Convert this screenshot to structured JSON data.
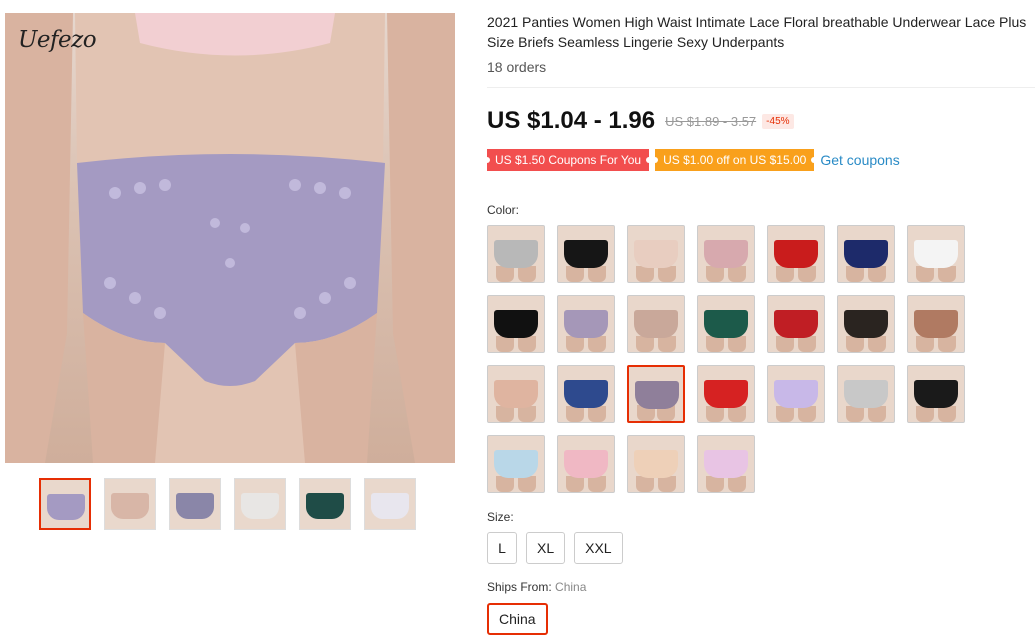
{
  "gallery": {
    "brand": "Uefezo",
    "thumbnails": [
      {
        "name": "thumb-1",
        "color": "#a49ac2",
        "active": true
      },
      {
        "name": "thumb-2",
        "color": "#d8b6a7",
        "active": false
      },
      {
        "name": "thumb-3",
        "color": "#8a86a8",
        "active": false
      },
      {
        "name": "thumb-4",
        "color": "#e8e6e4",
        "active": false
      },
      {
        "name": "thumb-5",
        "color": "#1f4c47",
        "active": false
      },
      {
        "name": "thumb-6",
        "color": "#e8e6ee",
        "active": false
      }
    ]
  },
  "product": {
    "title": "2021 Panties Women High Waist Intimate Lace Floral breathable Underwear Lace Plus Size Briefs Seamless Lingerie Sexy Underpants",
    "orders": "18 orders",
    "price": "US $1.04 - 1.96",
    "original_price": "US $1.89 - 3.57",
    "discount": "-45%",
    "coupons": {
      "coupon_1": "US $1.50 Coupons For You",
      "coupon_2": "US $1.00 off on US $15.00",
      "get_coupons": "Get coupons"
    },
    "color_label": "Color:",
    "colors": [
      {
        "color": "#b8b8b8",
        "selected": false
      },
      {
        "color": "#161616",
        "selected": false
      },
      {
        "color": "#e8cdc0",
        "selected": false
      },
      {
        "color": "#d7a9ae",
        "selected": false
      },
      {
        "color": "#c91c1c",
        "selected": false
      },
      {
        "color": "#1d2a6a",
        "selected": false
      },
      {
        "color": "#f4f4f4",
        "selected": false
      },
      {
        "color": "#111111",
        "selected": false
      },
      {
        "color": "#a597b8",
        "selected": false
      },
      {
        "color": "#c9a89a",
        "selected": false
      },
      {
        "color": "#1c5a4a",
        "selected": false
      },
      {
        "color": "#c01e24",
        "selected": false
      },
      {
        "color": "#2a2420",
        "selected": false
      },
      {
        "color": "#b07a62",
        "selected": false
      },
      {
        "color": "#dfb4a0",
        "selected": false
      },
      {
        "color": "#2e4a8e",
        "selected": false
      },
      {
        "color": "#8f7f9a",
        "selected": true
      },
      {
        "color": "#d62222",
        "selected": false
      },
      {
        "color": "#c8b8e8",
        "selected": false
      },
      {
        "color": "#c8c8c8",
        "selected": false
      },
      {
        "color": "#1a1a1a",
        "selected": false
      },
      {
        "color": "#b9d7e8",
        "selected": false
      },
      {
        "color": "#f0b8c4",
        "selected": false
      },
      {
        "color": "#eed0b8",
        "selected": false
      },
      {
        "color": "#e8c4e4",
        "selected": false
      }
    ],
    "size_label": "Size:",
    "sizes": [
      "L",
      "XL",
      "XXL"
    ],
    "ships_from_label": "Ships From:",
    "ships_from_value": "China",
    "ships_option": "China"
  }
}
